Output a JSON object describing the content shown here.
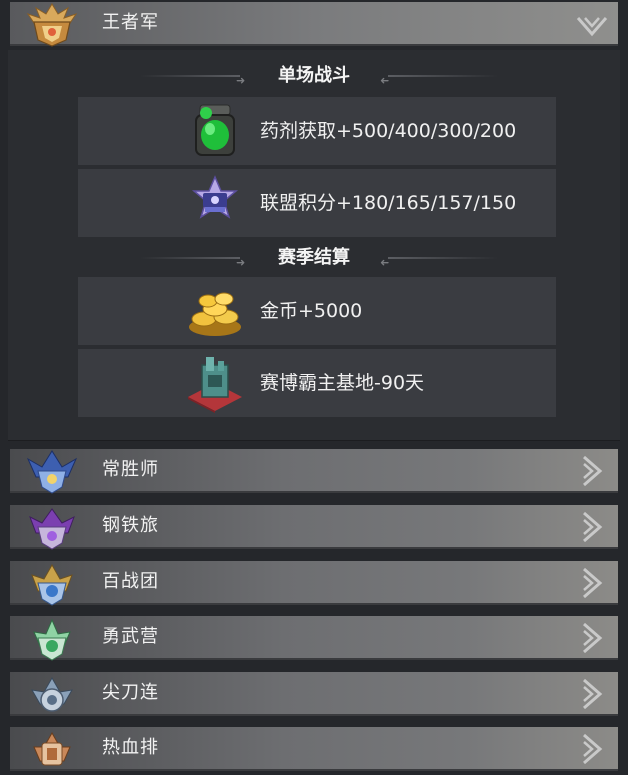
{
  "tiers": [
    {
      "name": "王者军",
      "expanded": true,
      "badge_icon": "king-badge-icon",
      "color": "#c79a52"
    },
    {
      "name": "常胜师",
      "expanded": false,
      "badge_icon": "ever-victorious-badge-icon",
      "color": "#3d5fb0"
    },
    {
      "name": "钢铁旅",
      "expanded": false,
      "badge_icon": "steel-badge-icon",
      "color": "#7b3fb0"
    },
    {
      "name": "百战团",
      "expanded": false,
      "badge_icon": "hundred-battles-badge-icon",
      "color": "#3a77c9"
    },
    {
      "name": "勇武营",
      "expanded": false,
      "badge_icon": "valor-badge-icon",
      "color": "#39a760"
    },
    {
      "name": "尖刀连",
      "expanded": false,
      "badge_icon": "spearhead-badge-icon",
      "color": "#8aa0b8"
    },
    {
      "name": "热血排",
      "expanded": false,
      "badge_icon": "hot-blood-badge-icon",
      "color": "#b06a3a"
    }
  ],
  "panel": {
    "single_battle": {
      "title": "单场战斗",
      "rewards": [
        {
          "icon": "green-potion-icon",
          "text": "药剂获取+500/400/300/200"
        },
        {
          "icon": "alliance-points-icon",
          "text": "联盟积分+180/165/157/150"
        }
      ]
    },
    "season_settlement": {
      "title": "赛季结算",
      "rewards": [
        {
          "icon": "gold-coins-icon",
          "text": "金币+5000"
        },
        {
          "icon": "cyber-base-icon",
          "text": "赛博霸主基地-90天"
        }
      ]
    }
  }
}
